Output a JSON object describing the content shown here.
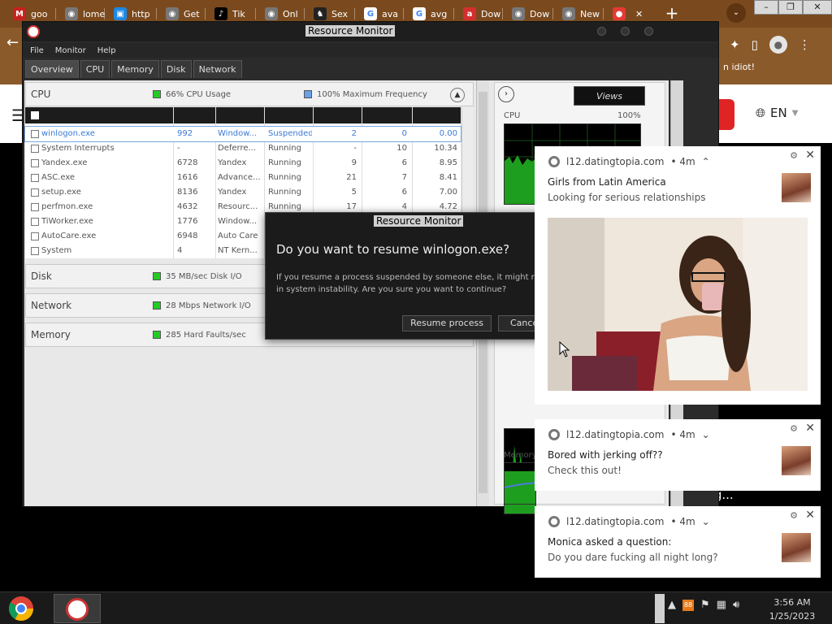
{
  "browser": {
    "tabs": [
      {
        "label": "goo",
        "icon": "gmail-icon",
        "color": "#c5221f",
        "glyph": "M"
      },
      {
        "label": "lome",
        "icon": "globe-icon",
        "color": "#777777",
        "glyph": "◉"
      },
      {
        "label": "http",
        "icon": "page-icon",
        "color": "#1e88e5",
        "glyph": "▣"
      },
      {
        "label": "Get",
        "icon": "chrome-icon",
        "color": "#777777",
        "glyph": "◉"
      },
      {
        "label": "Tik",
        "icon": "tiktok-icon",
        "color": "#000000",
        "glyph": "♪"
      },
      {
        "label": "Onl",
        "icon": "chrome-icon",
        "color": "#777777",
        "glyph": "◉"
      },
      {
        "label": "Sex",
        "icon": "figure-icon",
        "color": "#222222",
        "glyph": "♞"
      },
      {
        "label": "ava",
        "icon": "google-icon",
        "color": "#ffffff",
        "glyph": "G"
      },
      {
        "label": "avg",
        "icon": "google-icon",
        "color": "#ffffff",
        "glyph": "G"
      },
      {
        "label": "Dow",
        "icon": "avira-icon",
        "color": "#d32f2f",
        "glyph": "a"
      },
      {
        "label": "Dow",
        "icon": "chrome-icon",
        "color": "#777777",
        "glyph": "◉"
      },
      {
        "label": "New",
        "icon": "chrome-icon",
        "color": "#777777",
        "glyph": "◉"
      },
      {
        "label": "",
        "icon": "video-icon",
        "color": "#e53935",
        "glyph": "●"
      }
    ],
    "new_tab": "+",
    "tab_search": "⌄",
    "window_controls": [
      "–",
      "❐",
      "✕"
    ],
    "bookmark_text": "n idiot!",
    "language": "EN",
    "installing_text": "Installing..."
  },
  "rm": {
    "title": "Resource Monitor",
    "menu": [
      "File",
      "Monitor",
      "Help"
    ],
    "tabs": [
      "Overview",
      "CPU",
      "Memory",
      "Disk",
      "Network"
    ],
    "cpu": {
      "title": "CPU",
      "stat1": "66% CPU Usage",
      "stat1_color": "#22cc22",
      "stat2": "100% Maximum Frequency",
      "stat2_color": "#6aa0e8"
    },
    "processes": [
      {
        "name": "winlogon.exe",
        "pid": "992",
        "desc": "Window...",
        "status": "Suspended",
        "threads": "2",
        "cpu": "0",
        "avg": "0.00"
      },
      {
        "name": "System Interrupts",
        "pid": "-",
        "desc": "Deferre...",
        "status": "Running",
        "threads": "-",
        "cpu": "10",
        "avg": "10.34"
      },
      {
        "name": "Yandex.exe",
        "pid": "6728",
        "desc": "Yandex",
        "status": "Running",
        "threads": "9",
        "cpu": "6",
        "avg": "8.95"
      },
      {
        "name": "ASC.exe",
        "pid": "1616",
        "desc": "Advance...",
        "status": "Running",
        "threads": "21",
        "cpu": "7",
        "avg": "8.41"
      },
      {
        "name": "setup.exe",
        "pid": "8136",
        "desc": "Yandex",
        "status": "Running",
        "threads": "5",
        "cpu": "6",
        "avg": "7.00"
      },
      {
        "name": "perfmon.exe",
        "pid": "4632",
        "desc": "Resourc...",
        "status": "Running",
        "threads": "17",
        "cpu": "4",
        "avg": "4.72"
      },
      {
        "name": "TiWorker.exe",
        "pid": "1776",
        "desc": "Window...",
        "status": "",
        "threads": "",
        "cpu": "",
        "avg": ""
      },
      {
        "name": "AutoCare.exe",
        "pid": "6948",
        "desc": "Auto Care",
        "status": "",
        "threads": "",
        "cpu": "",
        "avg": ""
      },
      {
        "name": "System",
        "pid": "4",
        "desc": "NT Kern...",
        "status": "",
        "threads": "",
        "cpu": "",
        "avg": ""
      }
    ],
    "disk": {
      "title": "Disk",
      "stat": "35 MB/sec Disk I/O",
      "color": "#22cc22"
    },
    "network": {
      "title": "Network",
      "stat": "28 Mbps Network I/O",
      "color": "#22cc22"
    },
    "memory": {
      "title": "Memory",
      "stat": "285 Hard Faults/sec",
      "color": "#22cc22"
    },
    "graphs": {
      "views_label": "Views",
      "cpu_label": "CPU",
      "cpu_pct": "100%",
      "network_label": "Netw",
      "memory_label": "Memory"
    }
  },
  "dialog": {
    "title": "Resource Monitor",
    "heading": "Do you want to resume winlogon.exe?",
    "body_line1": "If you resume a process suspended by someone else, it might re",
    "body_line2": "in system instability. Are you sure you want to continue?",
    "resume_label": "Resume process",
    "cancel_label": "Cance"
  },
  "notifications": [
    {
      "source": "l12.datingtopia.com",
      "time": "• 4m",
      "chevron": "⌃",
      "title": "Girls from Latin America",
      "message": "Looking for serious relationships"
    },
    {
      "source": "l12.datingtopia.com",
      "time": "• 4m",
      "chevron": "⌄",
      "title": "Bored with jerking off??",
      "message": "Check this out!"
    },
    {
      "source": "l12.datingtopia.com",
      "time": "• 4m",
      "chevron": "⌄",
      "title": "Monica asked a question:",
      "message": "Do you dare fucking all night long?"
    }
  ],
  "taskbar": {
    "time": "3:56 AM",
    "date": "1/25/2023",
    "tray_badge": "88"
  }
}
